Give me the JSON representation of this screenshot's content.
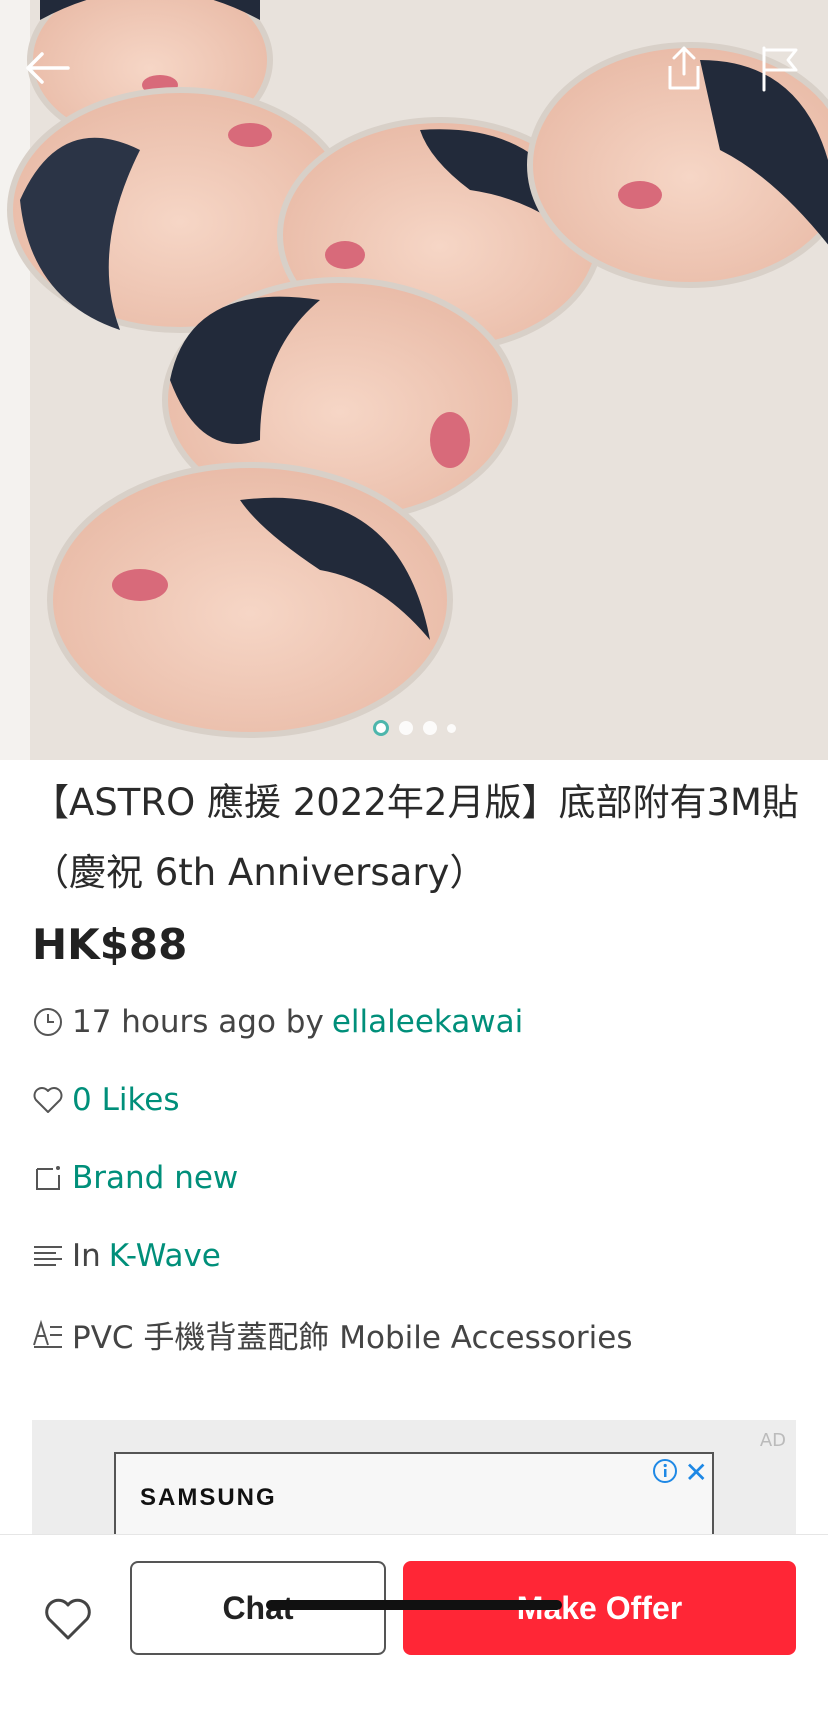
{
  "listing": {
    "title": "【ASTRO 應援 2022年2月版】底部附有3M貼 （慶祝 6th Anniversary）",
    "price": "HK$88",
    "time_ago": "17 hours ago by",
    "seller": "ellaleekawai",
    "likes": "0 Likes",
    "condition": "Brand new",
    "category_prefix": "In",
    "category": "K-Wave",
    "subcategory": "PVC 手機背蓋配飾 Mobile Accessories"
  },
  "gallery": {
    "image_count": 4,
    "current_index": 0
  },
  "ad": {
    "tag": "AD",
    "brand": "SAMSUNG"
  },
  "actions": {
    "chat_label": "Chat",
    "offer_label": "Make Offer"
  },
  "colors": {
    "accent": "#008f7a",
    "offer": "#ff2636"
  },
  "icons": [
    "back-arrow-icon",
    "share-icon",
    "flag-icon",
    "clock-icon",
    "heart-icon",
    "condition-icon",
    "category-icon",
    "subcategory-icon",
    "info-icon",
    "close-icon"
  ]
}
